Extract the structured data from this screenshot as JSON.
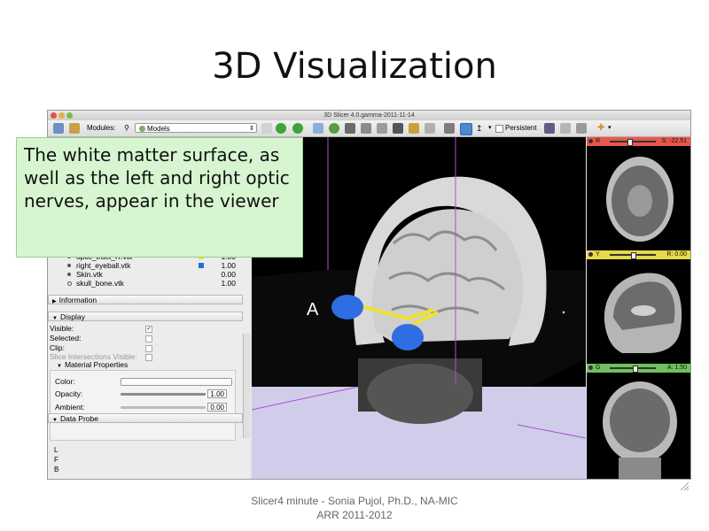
{
  "slide": {
    "title": "3D Visualization",
    "footer_line1": "Slicer4 minute - Sonia Pujol, Ph.D., NA-MIC",
    "footer_line2": "ARR 2011-2012"
  },
  "window": {
    "title": "3D Slicer 4.0.gamma-2011-11-14"
  },
  "toolbar": {
    "modules_label": "Modules:",
    "modules_value": "Models",
    "persistent_label": "Persistent"
  },
  "callout": {
    "text": "The white matter surface, as well as the left and right optic nerves, appear in the viewer"
  },
  "models_list": [
    {
      "name": "optic_tract_R.vtk",
      "value": "1.00",
      "color": "#f1e61d"
    },
    {
      "name": "right_eyeball.vtk",
      "value": "1.00",
      "color": "#1f6fe0"
    },
    {
      "name": "Skin.vtk",
      "value": "0.00",
      "color": ""
    },
    {
      "name": "skull_bone.vtk",
      "value": "1.00",
      "color": ""
    }
  ],
  "panel": {
    "information_label": "Information",
    "display_label": "Display",
    "visible_label": "Visible:",
    "selected_label": "Selected:",
    "clip_label": "Clip:",
    "slice_intersections_label": "Slice Intersections Visible:",
    "material_properties_label": "Material Properties",
    "color_label": "Color:",
    "opacity_label": "Opacity:",
    "opacity_value": "1.00",
    "opacity_level": 1.0,
    "ambient_label": "Ambient:",
    "ambient_value": "0.00",
    "ambient_level": 0.0,
    "data_probe_label": "Data Probe",
    "axis_L": "L",
    "axis_F": "F",
    "axis_B": "B"
  },
  "view3d": {
    "orientation_label": "A"
  },
  "slices": [
    {
      "letter": "R",
      "value": "S: -22.51",
      "bar_color": "#e8574c"
    },
    {
      "letter": "Y",
      "value": "R: 0.00",
      "bar_color": "#e6d94a"
    },
    {
      "letter": "G",
      "value": "A: 1.50",
      "bar_color": "#6fc15e"
    }
  ]
}
